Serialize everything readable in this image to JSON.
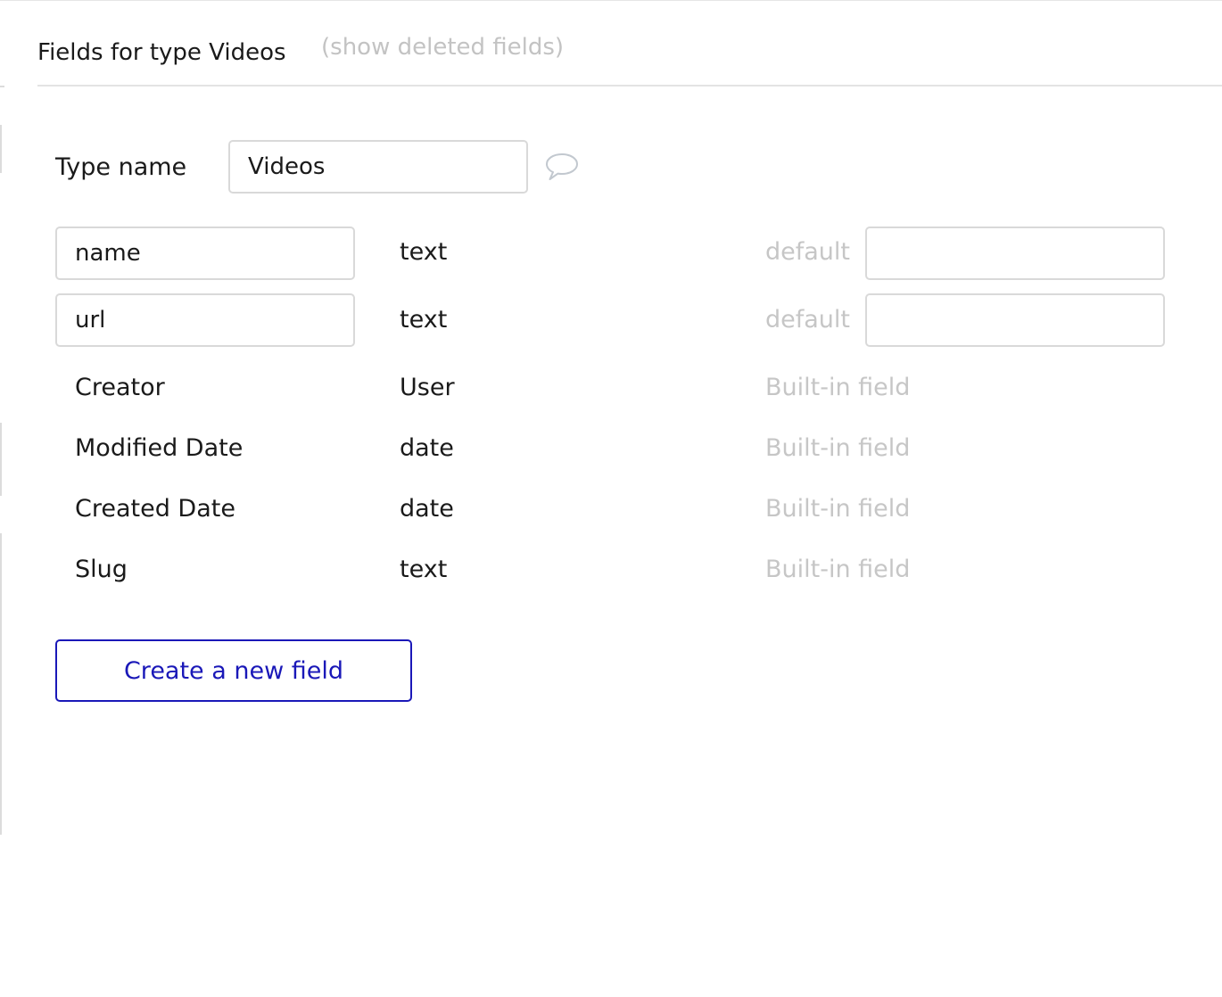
{
  "header": {
    "title": "Fields for type Videos",
    "show_deleted_link": "(show deleted fields)"
  },
  "type_name": {
    "label": "Type name",
    "value": "Videos",
    "comment_icon": "speech-bubble-icon"
  },
  "editable_fields": [
    {
      "name": "name",
      "type": "text",
      "default_label": "default",
      "default_value": ""
    },
    {
      "name": "url",
      "type": "text",
      "default_label": "default",
      "default_value": ""
    }
  ],
  "builtin_fields": [
    {
      "name": "Creator",
      "type": "User",
      "note": "Built-in field"
    },
    {
      "name": "Modified Date",
      "type": "date",
      "note": "Built-in field"
    },
    {
      "name": "Created Date",
      "type": "date",
      "note": "Built-in field"
    },
    {
      "name": "Slug",
      "type": "text",
      "note": "Built-in field"
    }
  ],
  "actions": {
    "create_field_label": "Create a new field"
  },
  "colors": {
    "accent": "#1a18b8",
    "muted_text": "#c6c6c6",
    "border": "#d9d9d9"
  }
}
